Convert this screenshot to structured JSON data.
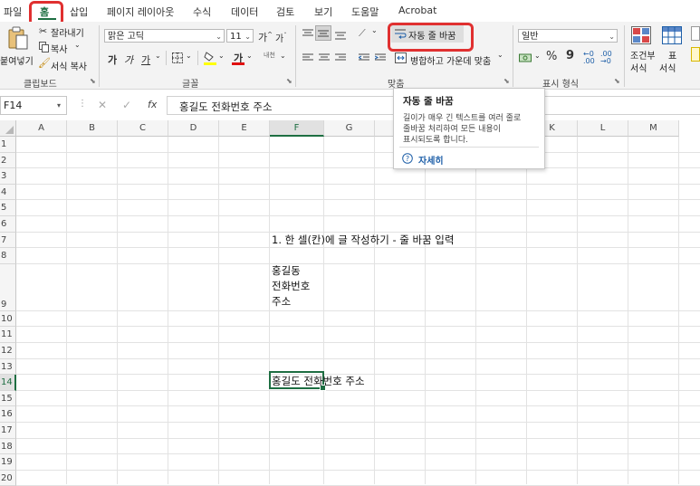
{
  "tabs": [
    "파일",
    "홈",
    "삽입",
    "페이지 레이아웃",
    "수식",
    "데이터",
    "검토",
    "보기",
    "도움말",
    "Acrobat"
  ],
  "clipboard": {
    "paste": "붙여넣기",
    "cut": "잘라내기",
    "copy": "복사",
    "format_painter": "서식 복사",
    "label": "클립보드"
  },
  "font": {
    "name": "맑은 고딕",
    "size": "11",
    "grow": "가",
    "shrink": "가",
    "bold": "가",
    "italic": "가",
    "underline": "가",
    "color_letter": "가",
    "phonetic": "내천",
    "label": "글꼴"
  },
  "alignment": {
    "wrap_text": "자동 줄 바꿈",
    "merge_center": "병합하고 가운데 맞춤",
    "label": "맞춤"
  },
  "number": {
    "format": "일반",
    "percent": "%",
    "comma": "9",
    "label": "표시 형식"
  },
  "styles": {
    "conditional": "조건부",
    "conditional_2": "서식",
    "table": "표",
    "table_2": "서식"
  },
  "formula_bar": {
    "name_box": "F14",
    "fx": "fx",
    "content": "홍길도 전화번호 주소"
  },
  "columns": [
    "A",
    "B",
    "C",
    "D",
    "E",
    "F",
    "G",
    "H",
    "I",
    "J",
    "K",
    "L",
    "M"
  ],
  "rows": [
    "1",
    "2",
    "3",
    "4",
    "5",
    "6",
    "7",
    "8",
    "9",
    "10",
    "11",
    "12",
    "13",
    "14",
    "15",
    "16",
    "17",
    "18",
    "19",
    "20"
  ],
  "cells": {
    "F7": "1. 한 셀(칸)에 글 작성하기 - 줄 바꿈 입력",
    "F9_line1": "홍길동",
    "F9_line2": "전화번호",
    "F9_line3": "주소",
    "F14": "홍길도 전화번호 주소"
  },
  "tooltip": {
    "title": "자동 줄 바꿈",
    "line1": "길이가 매우 긴 텍스트를 여러 줄로",
    "line2": "줄바꿈 처리하여 모든 내용이",
    "line3": "표시되도록 합니다.",
    "more": "자세히"
  },
  "colors": {
    "accent": "#1e6e42",
    "highlight_box": "#e03030",
    "link": "#1e5fa8"
  },
  "icons": [
    "paste-icon",
    "scissors-icon",
    "copy-icon",
    "brush-icon",
    "bold-icon",
    "border-icon",
    "fill-color-icon",
    "font-color-icon",
    "align-top-icon",
    "align-middle-icon",
    "align-bottom-icon",
    "orientation-icon",
    "wrap-text-icon",
    "merge-icon",
    "currency-icon",
    "percent-icon",
    "comma-icon",
    "decimal-increase-icon",
    "decimal-decrease-icon",
    "conditional-format-icon",
    "table-format-icon",
    "help-circle-icon",
    "cancel-icon",
    "check-icon"
  ]
}
